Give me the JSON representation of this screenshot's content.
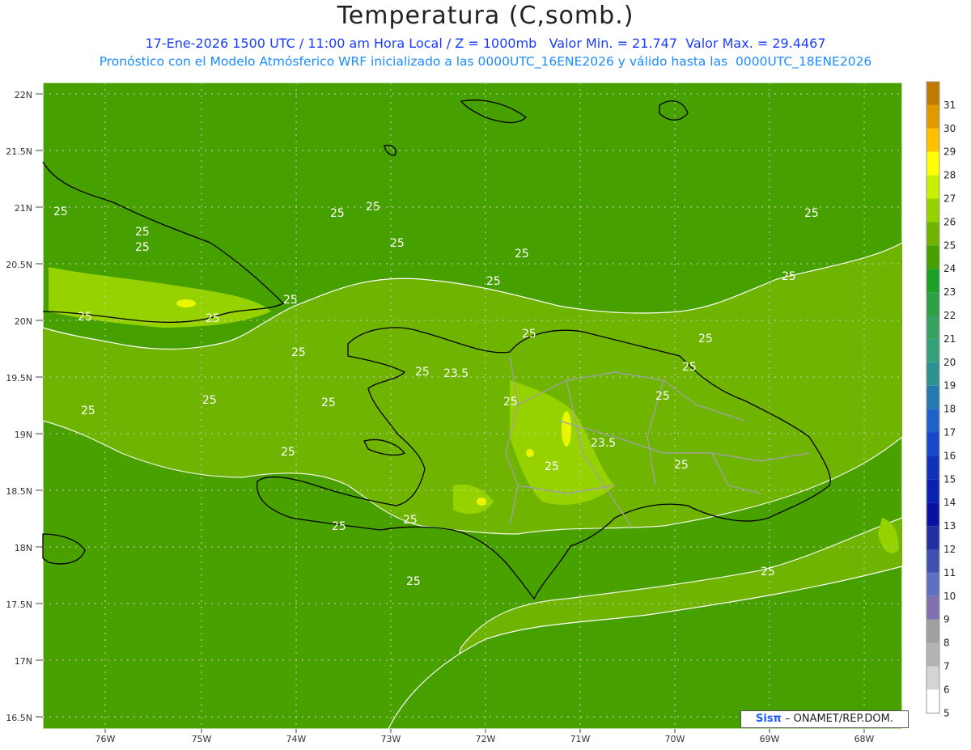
{
  "header": {
    "title": "Temperatura (C,somb.)",
    "line1": "17-Ene-2026 1500 UTC / 11:00 am Hora Local / Z = 1000mb   Valor Min. = 21.747  Valor Max. = 29.4467",
    "line2": "Pronóstico con el Modelo Atmósferico WRF inicializado a las 0000UTC_16ENE2026 y válido hasta las  0000UTC_18ENE2026"
  },
  "axes": {
    "lat_labels": [
      "22N",
      "21.5N",
      "21N",
      "20.5N",
      "20N",
      "19.5N",
      "19N",
      "18.5N",
      "18N",
      "17.5N",
      "17N",
      "16.5N"
    ],
    "lon_labels": [
      "76W",
      "75W",
      "74W",
      "73W",
      "72W",
      "71W",
      "70W",
      "69W",
      "68W"
    ]
  },
  "contour_labels": [
    "25",
    "25",
    "25",
    "25",
    "25",
    "25",
    "25",
    "25",
    "25",
    "25",
    "25",
    "25",
    "25",
    "25",
    "25",
    "25",
    "25",
    "23.5",
    "23.5",
    "25",
    "25",
    "25",
    "25",
    "25",
    "25",
    "25",
    "25",
    "25",
    "25",
    "25",
    "25",
    "25"
  ],
  "colorbar": {
    "labels": [
      "31",
      "30",
      "29",
      "28",
      "27",
      "26",
      "25",
      "24",
      "23",
      "22",
      "21",
      "20",
      "19",
      "18",
      "17",
      "16",
      "15",
      "14",
      "13",
      "12",
      "11",
      "10",
      "9",
      "8",
      "7",
      "6",
      "5"
    ],
    "colors": [
      "#c07a00",
      "#e09a00",
      "#ffc000",
      "#ffff00",
      "#c8f000",
      "#96d200",
      "#6eb400",
      "#46a000",
      "#1ea028",
      "#2ca045",
      "#38a060",
      "#36a07a",
      "#2e9090",
      "#2878b0",
      "#2060c8",
      "#1848c8",
      "#1030b8",
      "#0a20b0",
      "#0a10a0",
      "#2030a0",
      "#4050b0",
      "#6070c0",
      "#8070b0",
      "#a0a0a0",
      "#b4b4b4",
      "#d4d4d4",
      "#ffffff"
    ]
  },
  "credit": {
    "brand": "Sisπ",
    "text": " – ONAMET/REP.DOM."
  },
  "colors": {
    "field_low": "#46a000",
    "field_mid": "#6eb400",
    "field_high": "#96d200",
    "hot_spot": "#ffff00",
    "contour": "#ffffff",
    "coast": "#000000",
    "provinces": "#a0a0a0"
  }
}
